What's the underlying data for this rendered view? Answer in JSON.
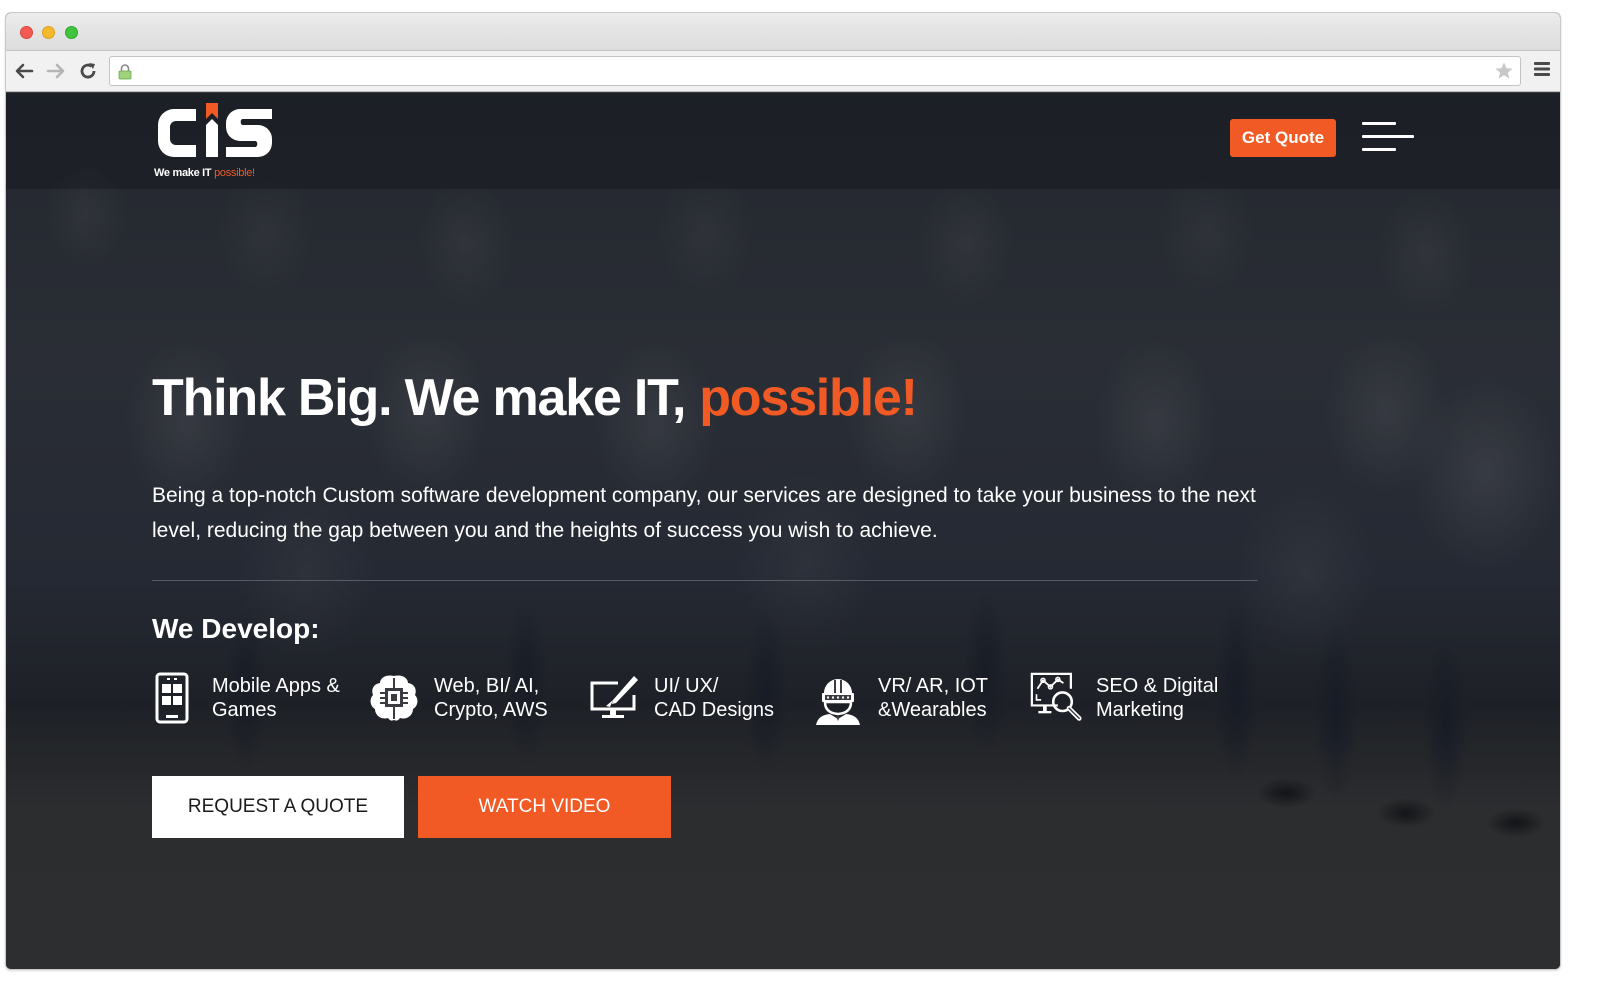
{
  "browser": {
    "url": "",
    "icons": {
      "back": "arrow-left-icon",
      "forward": "arrow-right-icon",
      "reload": "reload-icon",
      "secure": "lock-icon",
      "bookmark": "star-icon",
      "menu": "hamburger-menu-icon"
    }
  },
  "header": {
    "logo_text": "CiS",
    "logo_tagline_prefix": "We make IT ",
    "logo_tagline_accent": "possible!",
    "get_quote_label": "Get Quote",
    "menu_icon": "hamburger-menu-icon"
  },
  "hero": {
    "headline_main": "Think Big. We make IT,",
    "headline_accent": "possible!",
    "lead": "Being a top-notch Custom software development company, our services are designed to take your business to the next level, reducing the gap between you and the heights of success you wish to achieve.",
    "develop_title": "We Develop:",
    "services": [
      {
        "icon": "mobile-app-icon",
        "line1": "Mobile Apps &",
        "line2": "Games"
      },
      {
        "icon": "ai-brain-chip-icon",
        "line1": "Web, BI/ AI,",
        "line2": "Crypto, AWS"
      },
      {
        "icon": "monitor-pen-icon",
        "line1": "UI/ UX/",
        "line2": "CAD Designs"
      },
      {
        "icon": "vr-headset-person-icon",
        "line1": "VR/ AR, IOT",
        "line2": "&Wearables"
      },
      {
        "icon": "seo-analytics-magnifier-icon",
        "line1": "SEO & Digital",
        "line2": "Marketing"
      }
    ],
    "cta_primary": "REQUEST A QUOTE",
    "cta_secondary": "WATCH VIDEO"
  },
  "colors": {
    "accent": "#f15a24",
    "text": "#ffffff",
    "page_bg": "#3b3b3b"
  }
}
